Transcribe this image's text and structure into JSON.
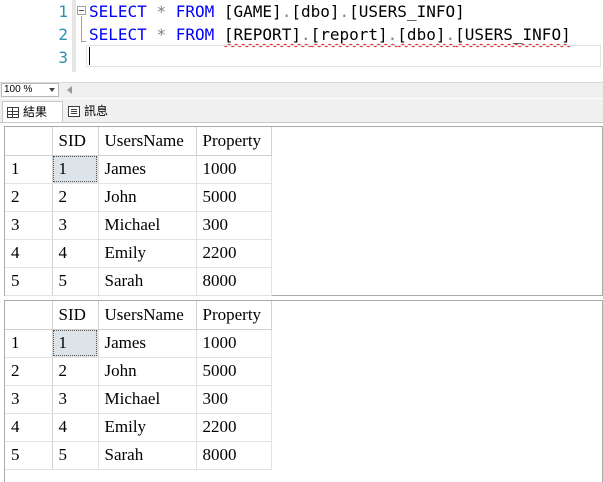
{
  "editor": {
    "line_numbers": [
      "1",
      "2",
      "3"
    ],
    "line1": {
      "select": "SELECT",
      "star": "*",
      "from": "FROM",
      "db": "[GAME]",
      "dot1": ".",
      "schema": "[dbo]",
      "dot2": ".",
      "table": "[USERS_INFO]"
    },
    "line2": {
      "select": "SELECT",
      "star": "*",
      "from": "FROM",
      "server": "[REPORT]",
      "dot1": ".",
      "db": "[report]",
      "dot2": ".",
      "schema": "[dbo]",
      "dot3": ".",
      "table": "[USERS_INFO]"
    }
  },
  "zoom": {
    "value": "100 %"
  },
  "tabs": {
    "results": "結果",
    "messages": "訊息"
  },
  "columns": [
    "SID",
    "UsersName",
    "Property"
  ],
  "results1": [
    {
      "row": "1",
      "sid": "1",
      "name": "James",
      "property": "1000"
    },
    {
      "row": "2",
      "sid": "2",
      "name": "John",
      "property": "5000"
    },
    {
      "row": "3",
      "sid": "3",
      "name": "Michael",
      "property": "300"
    },
    {
      "row": "4",
      "sid": "4",
      "name": "Emily",
      "property": "2200"
    },
    {
      "row": "5",
      "sid": "5",
      "name": "Sarah",
      "property": "8000"
    }
  ],
  "results2": [
    {
      "row": "1",
      "sid": "1",
      "name": "James",
      "property": "1000"
    },
    {
      "row": "2",
      "sid": "2",
      "name": "John",
      "property": "5000"
    },
    {
      "row": "3",
      "sid": "3",
      "name": "Michael",
      "property": "300"
    },
    {
      "row": "4",
      "sid": "4",
      "name": "Emily",
      "property": "2200"
    },
    {
      "row": "5",
      "sid": "5",
      "name": "Sarah",
      "property": "8000"
    }
  ],
  "colors": {
    "keyword": "#0000ff",
    "line_number": "#2b91af",
    "operator": "#808080",
    "squiggle": "#e02020",
    "selected_cell": "#dce4ea"
  }
}
